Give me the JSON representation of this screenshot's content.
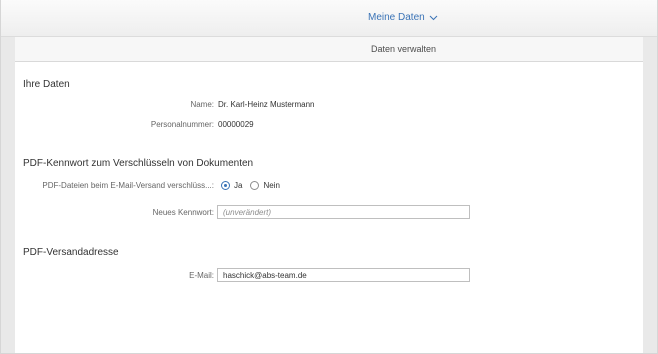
{
  "shell": {
    "title": "Meine Daten",
    "subtitle": "Daten verwalten"
  },
  "personal": {
    "heading": "Ihre Daten",
    "name_label": "Name:",
    "name_value": "Dr. Karl-Heinz Mustermann",
    "personnel_label": "Personalnummer:",
    "personnel_value": "00000029"
  },
  "pdf_password": {
    "heading": "PDF-Kennwort zum Verschlüsseln von Dokumenten",
    "encrypt_label": "PDF-Dateien beim E-Mail-Versand verschlüss...:",
    "option_yes": "Ja",
    "option_no": "Nein",
    "selected": "Ja",
    "new_password_label": "Neues Kennwort:",
    "new_password_placeholder": "(unverändert)"
  },
  "pdf_address": {
    "heading": "PDF-Versandadresse",
    "email_label": "E-Mail:",
    "email_value": "haschick@abs-team.de"
  },
  "icons": {
    "shell_dropdown": "chevron-down-icon"
  },
  "colors": {
    "accent": "#3a73b6",
    "background": "#f2f2f2",
    "content": "#ffffff"
  }
}
